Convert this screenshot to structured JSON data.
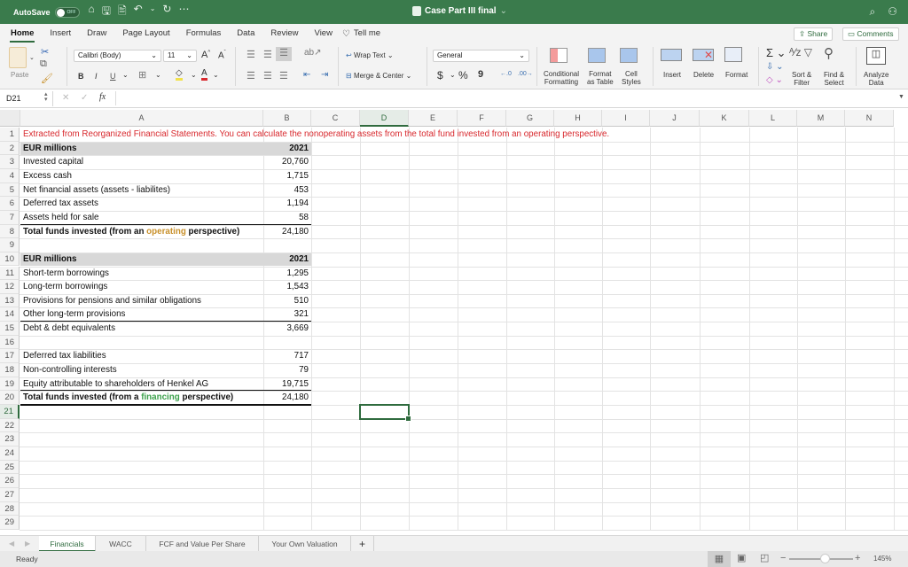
{
  "titlebar": {
    "autosave_label": "AutoSave",
    "autosave_state": "OFF",
    "doc_title": "Case Part III final",
    "quick_access": [
      "home-icon",
      "save-icon",
      "save-as-icon",
      "undo-icon",
      "redo-icon",
      "more-icon"
    ]
  },
  "tabs": [
    "Home",
    "Insert",
    "Draw",
    "Page Layout",
    "Formulas",
    "Data",
    "Review",
    "View",
    "Tell me"
  ],
  "active_tab": "Home",
  "share_label": "Share",
  "comments_label": "Comments",
  "ribbon": {
    "paste_label": "Paste",
    "font_name": "Calibri (Body)",
    "font_size": "11",
    "bold": "B",
    "italic": "I",
    "underline": "U",
    "wrap_text": "Wrap Text",
    "merge_center": "Merge & Center",
    "number_format": "General",
    "currency": "$",
    "percent": "%",
    "comma": "9",
    "conditional_formatting": [
      "Conditional",
      "Formatting"
    ],
    "format_as_table": [
      "Format",
      "as Table"
    ],
    "cell_styles": [
      "Cell",
      "Styles"
    ],
    "insert": "Insert",
    "delete": "Delete",
    "format": "Format",
    "sort_filter": [
      "Sort &",
      "Filter"
    ],
    "find_select": [
      "Find &",
      "Select"
    ],
    "analyze_data": [
      "Analyze",
      "Data"
    ]
  },
  "formula_bar": {
    "name_box": "D21",
    "fx": "fx",
    "formula": ""
  },
  "columns": [
    "A",
    "B",
    "C",
    "D",
    "E",
    "F",
    "G",
    "H",
    "I",
    "J",
    "K",
    "L",
    "M",
    "N"
  ],
  "selected_column": "D",
  "rows": [
    "1",
    "2",
    "3",
    "4",
    "5",
    "6",
    "7",
    "8",
    "9",
    "10",
    "11",
    "12",
    "13",
    "14",
    "15",
    "16",
    "17",
    "18",
    "19",
    "20",
    "21",
    "22",
    "23",
    "24",
    "25",
    "26",
    "27",
    "28",
    "29"
  ],
  "selected_row": "21",
  "sheet": {
    "r1": "Extracted from Reorganized Financial Statements. You can calculate the nonoperating assets from the total fund invested from an operating perspective.",
    "table1": {
      "header_label": "EUR millions",
      "header_year": "2021",
      "rows": [
        {
          "label": "Invested capital",
          "value": "20,760"
        },
        {
          "label": "Excess cash",
          "value": "1,715"
        },
        {
          "label": "Net financial assets (assets - liabilites)",
          "value": "453"
        },
        {
          "label": "Deferred tax assets",
          "value": "1,194"
        },
        {
          "label": "Assets held for sale",
          "value": "58"
        }
      ],
      "total_pre": "Total funds invested (from an ",
      "total_highlight": "operating",
      "total_post": " perspective)",
      "total_value": "24,180"
    },
    "table2": {
      "header_label": "EUR millions",
      "header_year": "2021",
      "rows": [
        {
          "label": "Short-term borrowings",
          "value": "1,295"
        },
        {
          "label": "Long-term borrowings",
          "value": "1,543"
        },
        {
          "label": "Provisions for pensions and similar obligations",
          "value": "510"
        },
        {
          "label": "Other long-term provisions",
          "value": "321"
        },
        {
          "label": "Debt & debt equivalents",
          "value": "3,669"
        }
      ],
      "rows2": [
        {
          "label": "Deferred tax liabilities",
          "value": "717"
        },
        {
          "label": "Non-controlling interests",
          "value": "79"
        },
        {
          "label": "Equity attributable to shareholders of Henkel AG",
          "value": "19,715"
        }
      ],
      "total_pre": "Total funds invested (from a ",
      "total_highlight": "financing",
      "total_post": " perspective)",
      "total_value": "24,180"
    }
  },
  "sheet_tabs": [
    "Financials",
    "WACC",
    "FCF and Value Per Share",
    "Your Own Valuation"
  ],
  "active_sheet": "Financials",
  "add_sheet": "+",
  "status": {
    "text": "Ready",
    "zoom": "145%",
    "zoom_level_percent": 145
  },
  "colors": {
    "brand_green": "#3a7b4c",
    "note_red": "#d8282d",
    "operating_orange": "#c8902a",
    "financing_green": "#3aa04a"
  }
}
